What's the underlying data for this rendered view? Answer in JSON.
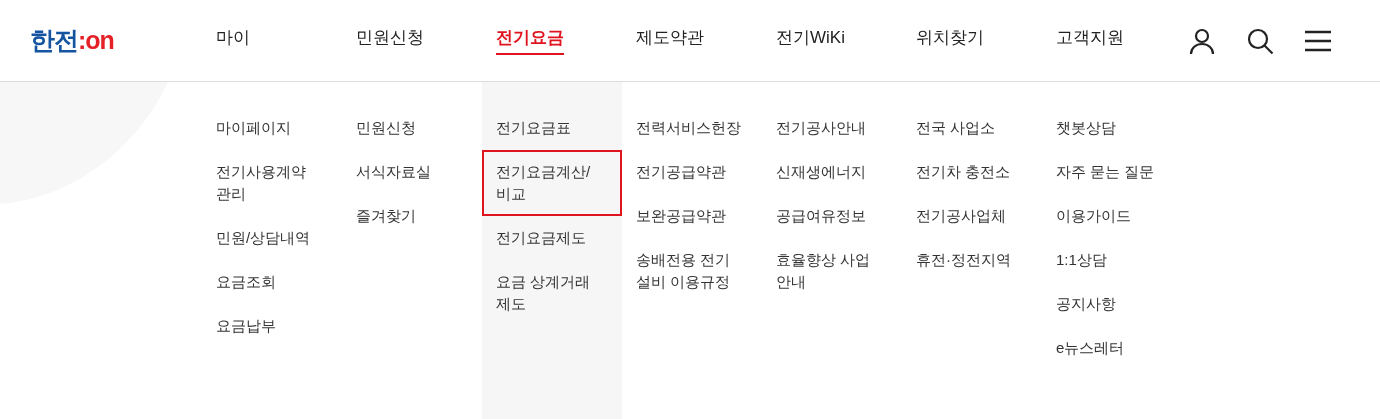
{
  "logo": {
    "main": "한전",
    "accent": ":on"
  },
  "nav": [
    {
      "label": "마이",
      "selected": false
    },
    {
      "label": "민원신청",
      "selected": false
    },
    {
      "label": "전기요금",
      "selected": true
    },
    {
      "label": "제도약관",
      "selected": false
    },
    {
      "label": "전기WiKi",
      "selected": false
    },
    {
      "label": "위치찾기",
      "selected": false
    },
    {
      "label": "고객지원",
      "selected": false
    }
  ],
  "menu_columns": [
    {
      "items": [
        {
          "label": "마이페이지",
          "selected": false
        },
        {
          "label": "전기사용계약 관리",
          "selected": false
        },
        {
          "label": "민원/상담내역",
          "selected": false
        },
        {
          "label": "요금조회",
          "selected": false
        },
        {
          "label": "요금납부",
          "selected": false
        }
      ]
    },
    {
      "items": [
        {
          "label": "민원신청",
          "selected": false
        },
        {
          "label": "서식자료실",
          "selected": false
        },
        {
          "label": "즐겨찾기",
          "selected": false
        }
      ]
    },
    {
      "items": [
        {
          "label": "전기요금표",
          "selected": false
        },
        {
          "label": "전기요금계산/ 비교",
          "selected": true
        },
        {
          "label": "전기요금제도",
          "selected": false
        },
        {
          "label": "요금 상계거래 제도",
          "selected": false
        }
      ]
    },
    {
      "items": [
        {
          "label": "전력서비스헌장",
          "selected": false
        },
        {
          "label": "전기공급약관",
          "selected": false
        },
        {
          "label": "보완공급약관",
          "selected": false
        },
        {
          "label": "송배전용 전기 설비 이용규정",
          "selected": false
        }
      ]
    },
    {
      "items": [
        {
          "label": "전기공사안내",
          "selected": false
        },
        {
          "label": "신재생에너지",
          "selected": false
        },
        {
          "label": "공급여유정보",
          "selected": false
        },
        {
          "label": "효율향상 사업 안내",
          "selected": false
        }
      ]
    },
    {
      "items": [
        {
          "label": "전국 사업소",
          "selected": false
        },
        {
          "label": "전기차 충전소",
          "selected": false
        },
        {
          "label": "전기공사업체",
          "selected": false
        },
        {
          "label": "휴전·정전지역",
          "selected": false
        }
      ]
    },
    {
      "items": [
        {
          "label": "챗봇상담",
          "selected": false
        },
        {
          "label": "자주 묻는 질문",
          "selected": false
        },
        {
          "label": "이용가이드",
          "selected": false
        },
        {
          "label": "1:1상담",
          "selected": false
        },
        {
          "label": "공지사항",
          "selected": false
        },
        {
          "label": "e뉴스레터",
          "selected": false
        }
      ]
    }
  ]
}
